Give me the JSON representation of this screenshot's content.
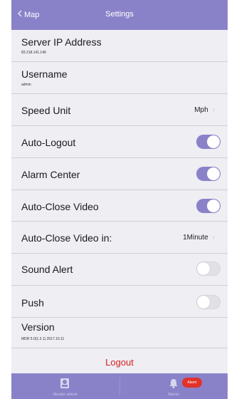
{
  "nav": {
    "back_label": "Map",
    "title": "Settings"
  },
  "settings": {
    "server_ip": {
      "label": "Server IP Address",
      "value": "83.218.141.146"
    },
    "username": {
      "label": "Username",
      "value": "admin"
    },
    "speed_unit": {
      "label": "Speed Unit",
      "value": "Mph"
    },
    "auto_logout": {
      "label": "Auto-Logout",
      "enabled": true
    },
    "alarm_center": {
      "label": "Alarm Center",
      "enabled": true
    },
    "auto_close_video": {
      "label": "Auto-Close Video",
      "enabled": true
    },
    "auto_close_video_in": {
      "label": "Auto-Close Video in:",
      "value": "1Minute"
    },
    "sound_alert": {
      "label": "Sound Alert",
      "enabled": false
    },
    "push": {
      "label": "Push",
      "enabled": false
    },
    "version": {
      "label": "Version",
      "value": "MDR 5.0(1.3.1) 2017.10.11"
    }
  },
  "logout_label": "Logout",
  "tabbar": {
    "monitor_label": "Monitor vehicle",
    "alarms_label": "Alarms",
    "alarm_badge": "Alarm"
  },
  "colors": {
    "accent": "#8a82c9",
    "danger": "#d42020",
    "background": "#eeeef3"
  }
}
